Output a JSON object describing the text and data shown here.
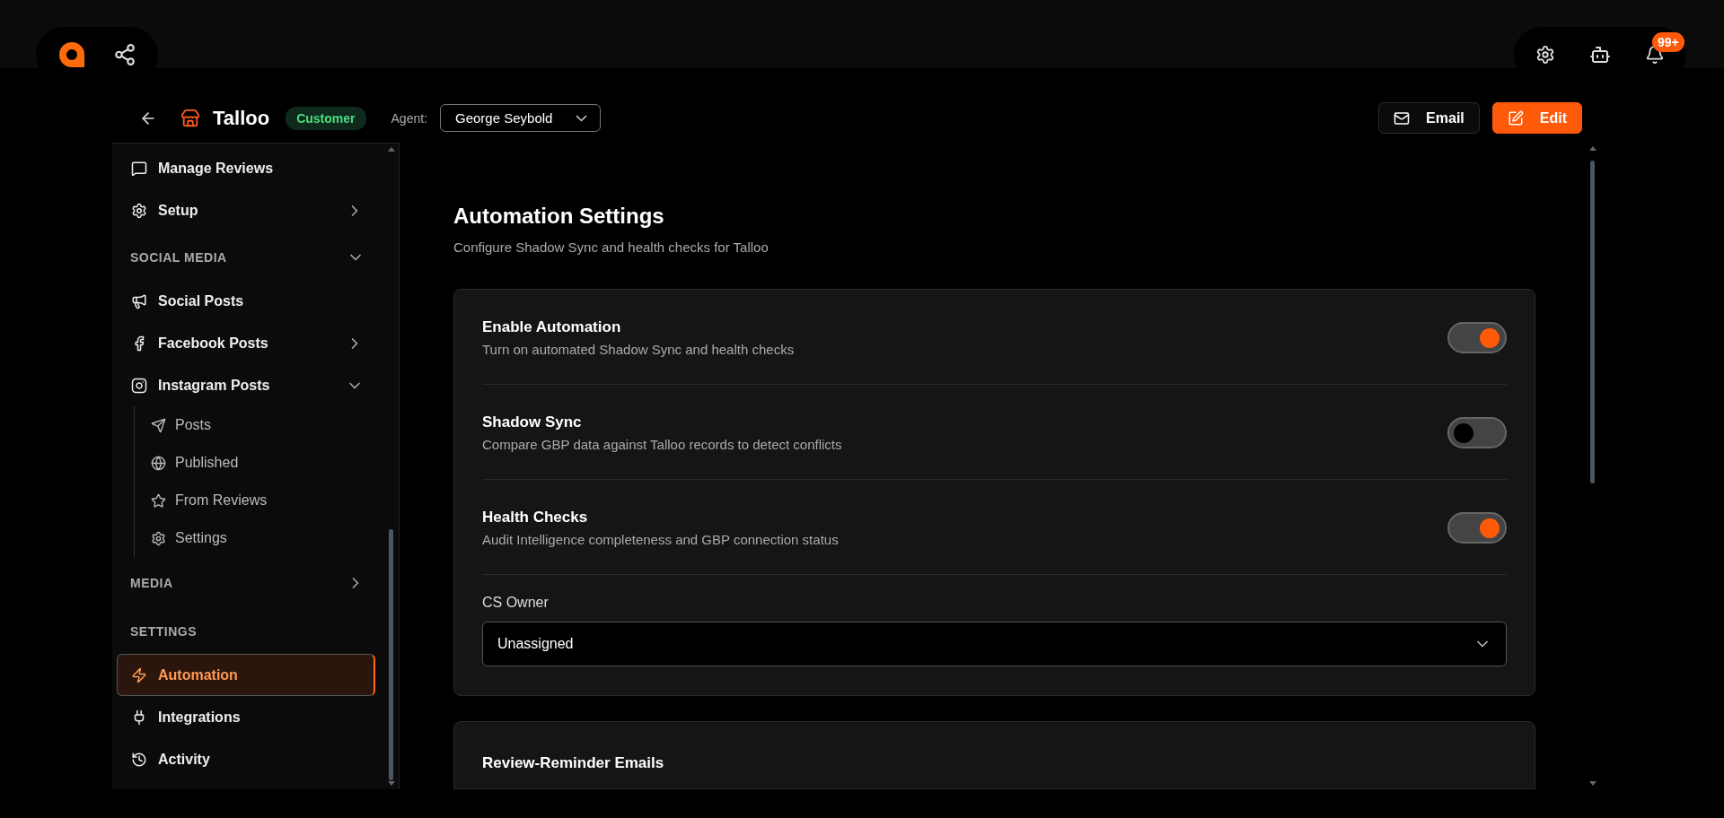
{
  "topbar": {
    "notifications_badge": "99+"
  },
  "header": {
    "title": "Talloo",
    "status_badge": "Customer",
    "agent_label": "Agent:",
    "agent_value": "George Seybold",
    "buttons": [
      {
        "kind": "outline",
        "label": "Email"
      },
      {
        "kind": "primary",
        "label": "Edit"
      }
    ]
  },
  "sidebar": {
    "items": [
      {
        "kind": "item",
        "label": "Manage Reviews",
        "selected": false
      },
      {
        "kind": "item",
        "label": "Setup",
        "selected": false,
        "expanded": false
      },
      {
        "kind": "section",
        "label": "SOCIAL MEDIA",
        "expanded": true
      },
      {
        "kind": "item",
        "label": "Social Posts",
        "selected": false
      },
      {
        "kind": "item",
        "label": "Facebook Posts",
        "selected": false,
        "expanded": false
      },
      {
        "kind": "item",
        "label": "Instagram Posts",
        "selected": false,
        "expanded": true,
        "children": [
          {
            "label": "Posts",
            "selected": false
          },
          {
            "label": "Published",
            "selected": false
          },
          {
            "label": "From Reviews",
            "selected": false
          },
          {
            "label": "Settings",
            "selected": false
          }
        ]
      },
      {
        "kind": "section",
        "label": "MEDIA",
        "expanded": false
      },
      {
        "kind": "section",
        "label": "SETTINGS"
      },
      {
        "kind": "item",
        "label": "Automation",
        "selected": true
      },
      {
        "kind": "item",
        "label": "Integrations",
        "selected": false
      },
      {
        "kind": "item",
        "label": "Activity",
        "selected": false
      }
    ]
  },
  "main": {
    "title": "Automation Settings",
    "subtitle": "Configure Shadow Sync and health checks for Talloo",
    "settings": [
      {
        "title": "Enable Automation",
        "description": "Turn on automated Shadow Sync and health checks",
        "on": true
      },
      {
        "title": "Shadow Sync",
        "description": "Compare GBP data against Talloo records to detect conflicts",
        "on": false
      },
      {
        "title": "Health Checks",
        "description": "Audit Intelligence completeness and GBP connection status",
        "on": true
      }
    ],
    "owner": {
      "label": "CS Owner",
      "value": "Unassigned"
    },
    "second_card": {
      "title": "Review-Reminder Emails"
    }
  }
}
